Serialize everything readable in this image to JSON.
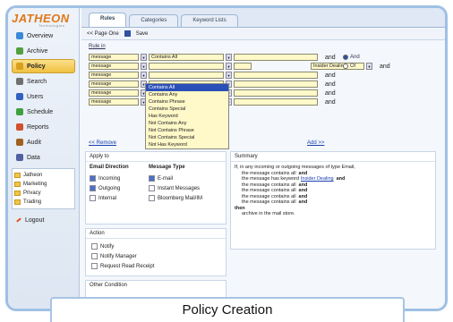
{
  "brand": "JATHEON",
  "tagline": "Technologies",
  "nav": [
    {
      "label": "Overview",
      "color": "#3a8ad8"
    },
    {
      "label": "Archive",
      "color": "#50a040"
    },
    {
      "label": "Policy",
      "color": "#d8a020",
      "active": true
    },
    {
      "label": "Search",
      "color": "#707070"
    },
    {
      "label": "Users",
      "color": "#3060c0"
    },
    {
      "label": "Schedule",
      "color": "#40a040"
    },
    {
      "label": "Reports",
      "color": "#d05030"
    },
    {
      "label": "Audit",
      "color": "#a06020"
    },
    {
      "label": "Data",
      "color": "#5060a0"
    }
  ],
  "folders": [
    "Jatheon",
    "Marketing",
    "Privacy",
    "Trading"
  ],
  "logout": "Logout",
  "tabs": [
    "Rules",
    "Categories",
    "Keyword Lists"
  ],
  "toolbar": {
    "page": "<< Page One",
    "save": "Save"
  },
  "rule_header": "Rule in",
  "rules": [
    {
      "field": "message",
      "op": "Contains All"
    },
    {
      "field": "message",
      "op": ""
    },
    {
      "field": "message",
      "op": ""
    },
    {
      "field": "message",
      "op": ""
    },
    {
      "field": "message",
      "op": ""
    },
    {
      "field": "message",
      "op": ""
    }
  ],
  "and_label": "and",
  "radio": {
    "and": "And",
    "or": "Or"
  },
  "insider": "Insider Dealing",
  "ops": [
    "Contains All",
    "Contains Any",
    "Contains Phrase",
    "Contains Special",
    "Has Keyword",
    "Not Contains Any",
    "Not Contains Phrase",
    "Not Contains Special",
    "Not Has Keyword"
  ],
  "remove": "<< Remove",
  "add": "Add >>",
  "apply": {
    "title": "Apply to",
    "dir_title": "Email Direction",
    "dirs": [
      "Incoming",
      "Outgoing",
      "Internal"
    ],
    "type_title": "Message Type",
    "types": [
      "E-mail",
      "Instant Messages",
      "Bloomberg Mail/IM"
    ]
  },
  "summary": {
    "title": "Summary",
    "intro": "If, in any incoming or outgoing messages of type Email,",
    "lines": [
      "the message contains all",
      "the message has keyword",
      "the message contains all",
      "the message contains all",
      "the message contains all",
      "the message contains all"
    ],
    "then": "then",
    "action": "archive in the mail store."
  },
  "action": {
    "title": "Action",
    "items": [
      "Notify",
      "Notify Manager",
      "Request Read Receipt"
    ]
  },
  "other": "Other Condition",
  "caption": "Policy Creation"
}
